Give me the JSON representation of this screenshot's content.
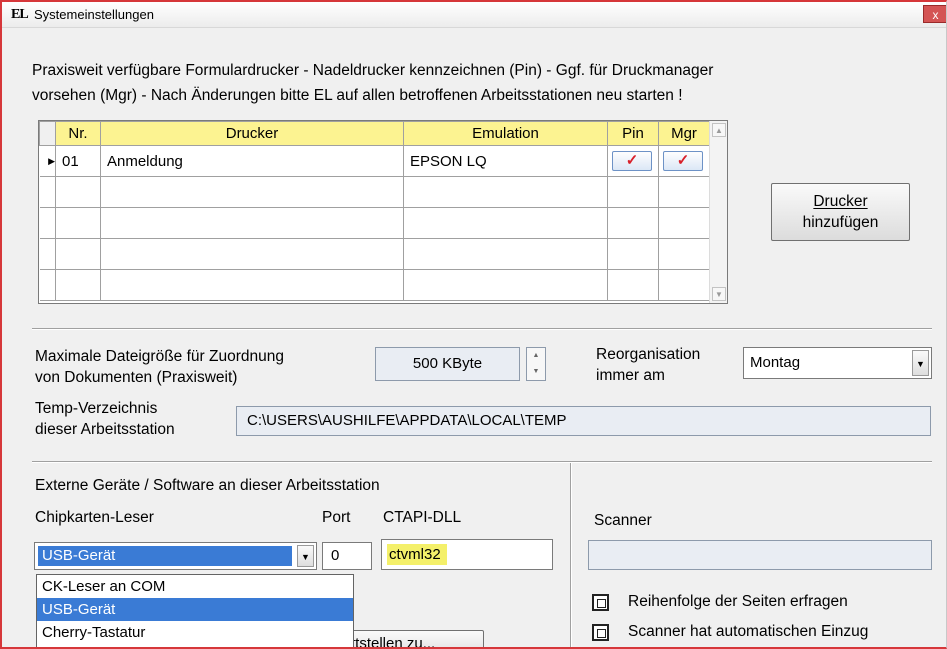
{
  "window": {
    "icon_label": "EL",
    "title": "Systemeinstellungen",
    "close_label": "x"
  },
  "info_lines": [
    "Praxisweit verfügbare Formulardrucker - Nadeldrucker kennzeichnen (Pin) - Ggf. für Druckmanager",
    "vorsehen (Mgr) - Nach Änderungen bitte EL auf allen betroffenen Arbeitsstationen neu starten !"
  ],
  "printer_table": {
    "headers": {
      "nr": "Nr.",
      "drucker": "Drucker",
      "emulation": "Emulation",
      "pin": "Pin",
      "mgr": "Mgr"
    },
    "rows": [
      {
        "nr": "01",
        "drucker": "Anmeldung",
        "emulation": "EPSON LQ",
        "pin_checked": true,
        "mgr_checked": true
      }
    ],
    "check_glyph": "✓",
    "row_marker": "▶"
  },
  "add_printer_button": {
    "line1": "Drucker",
    "line2": "hinzufügen"
  },
  "file_size": {
    "label_line1": "Maximale Dateigröße für Zuordnung",
    "label_line2": "von Dokumenten (Praxisweit)",
    "value": "500 KByte"
  },
  "reorg": {
    "label_line1": "Reorganisation",
    "label_line2": "immer am",
    "value": "Montag"
  },
  "temp_dir": {
    "label_line1": "Temp-Verzeichnis",
    "label_line2": "dieser Arbeitsstation",
    "value": "C:\\USERS\\AUSHILFE\\APPDATA\\LOCAL\\TEMP"
  },
  "external": {
    "section_title": "Externe Geräte / Software an dieser Arbeitsstation",
    "chipcard_label": "Chipkarten-Leser",
    "port_label": "Port",
    "dll_label": "CTAPI-DLL",
    "chipcard_value": "USB-Gerät",
    "port_value": "0",
    "dll_value": "ctvml32",
    "dropdown_options": [
      "CK-Leser an COM",
      "USB-Gerät",
      "Cherry-Tastatur"
    ],
    "dropdown_selected_index": 1,
    "partial_button_label": "ttstellen zu..."
  },
  "scanner": {
    "label": "Scanner",
    "value": "",
    "option1": "Reihenfolge der Seiten erfragen",
    "option2": "Scanner hat automatischen Einzug"
  }
}
